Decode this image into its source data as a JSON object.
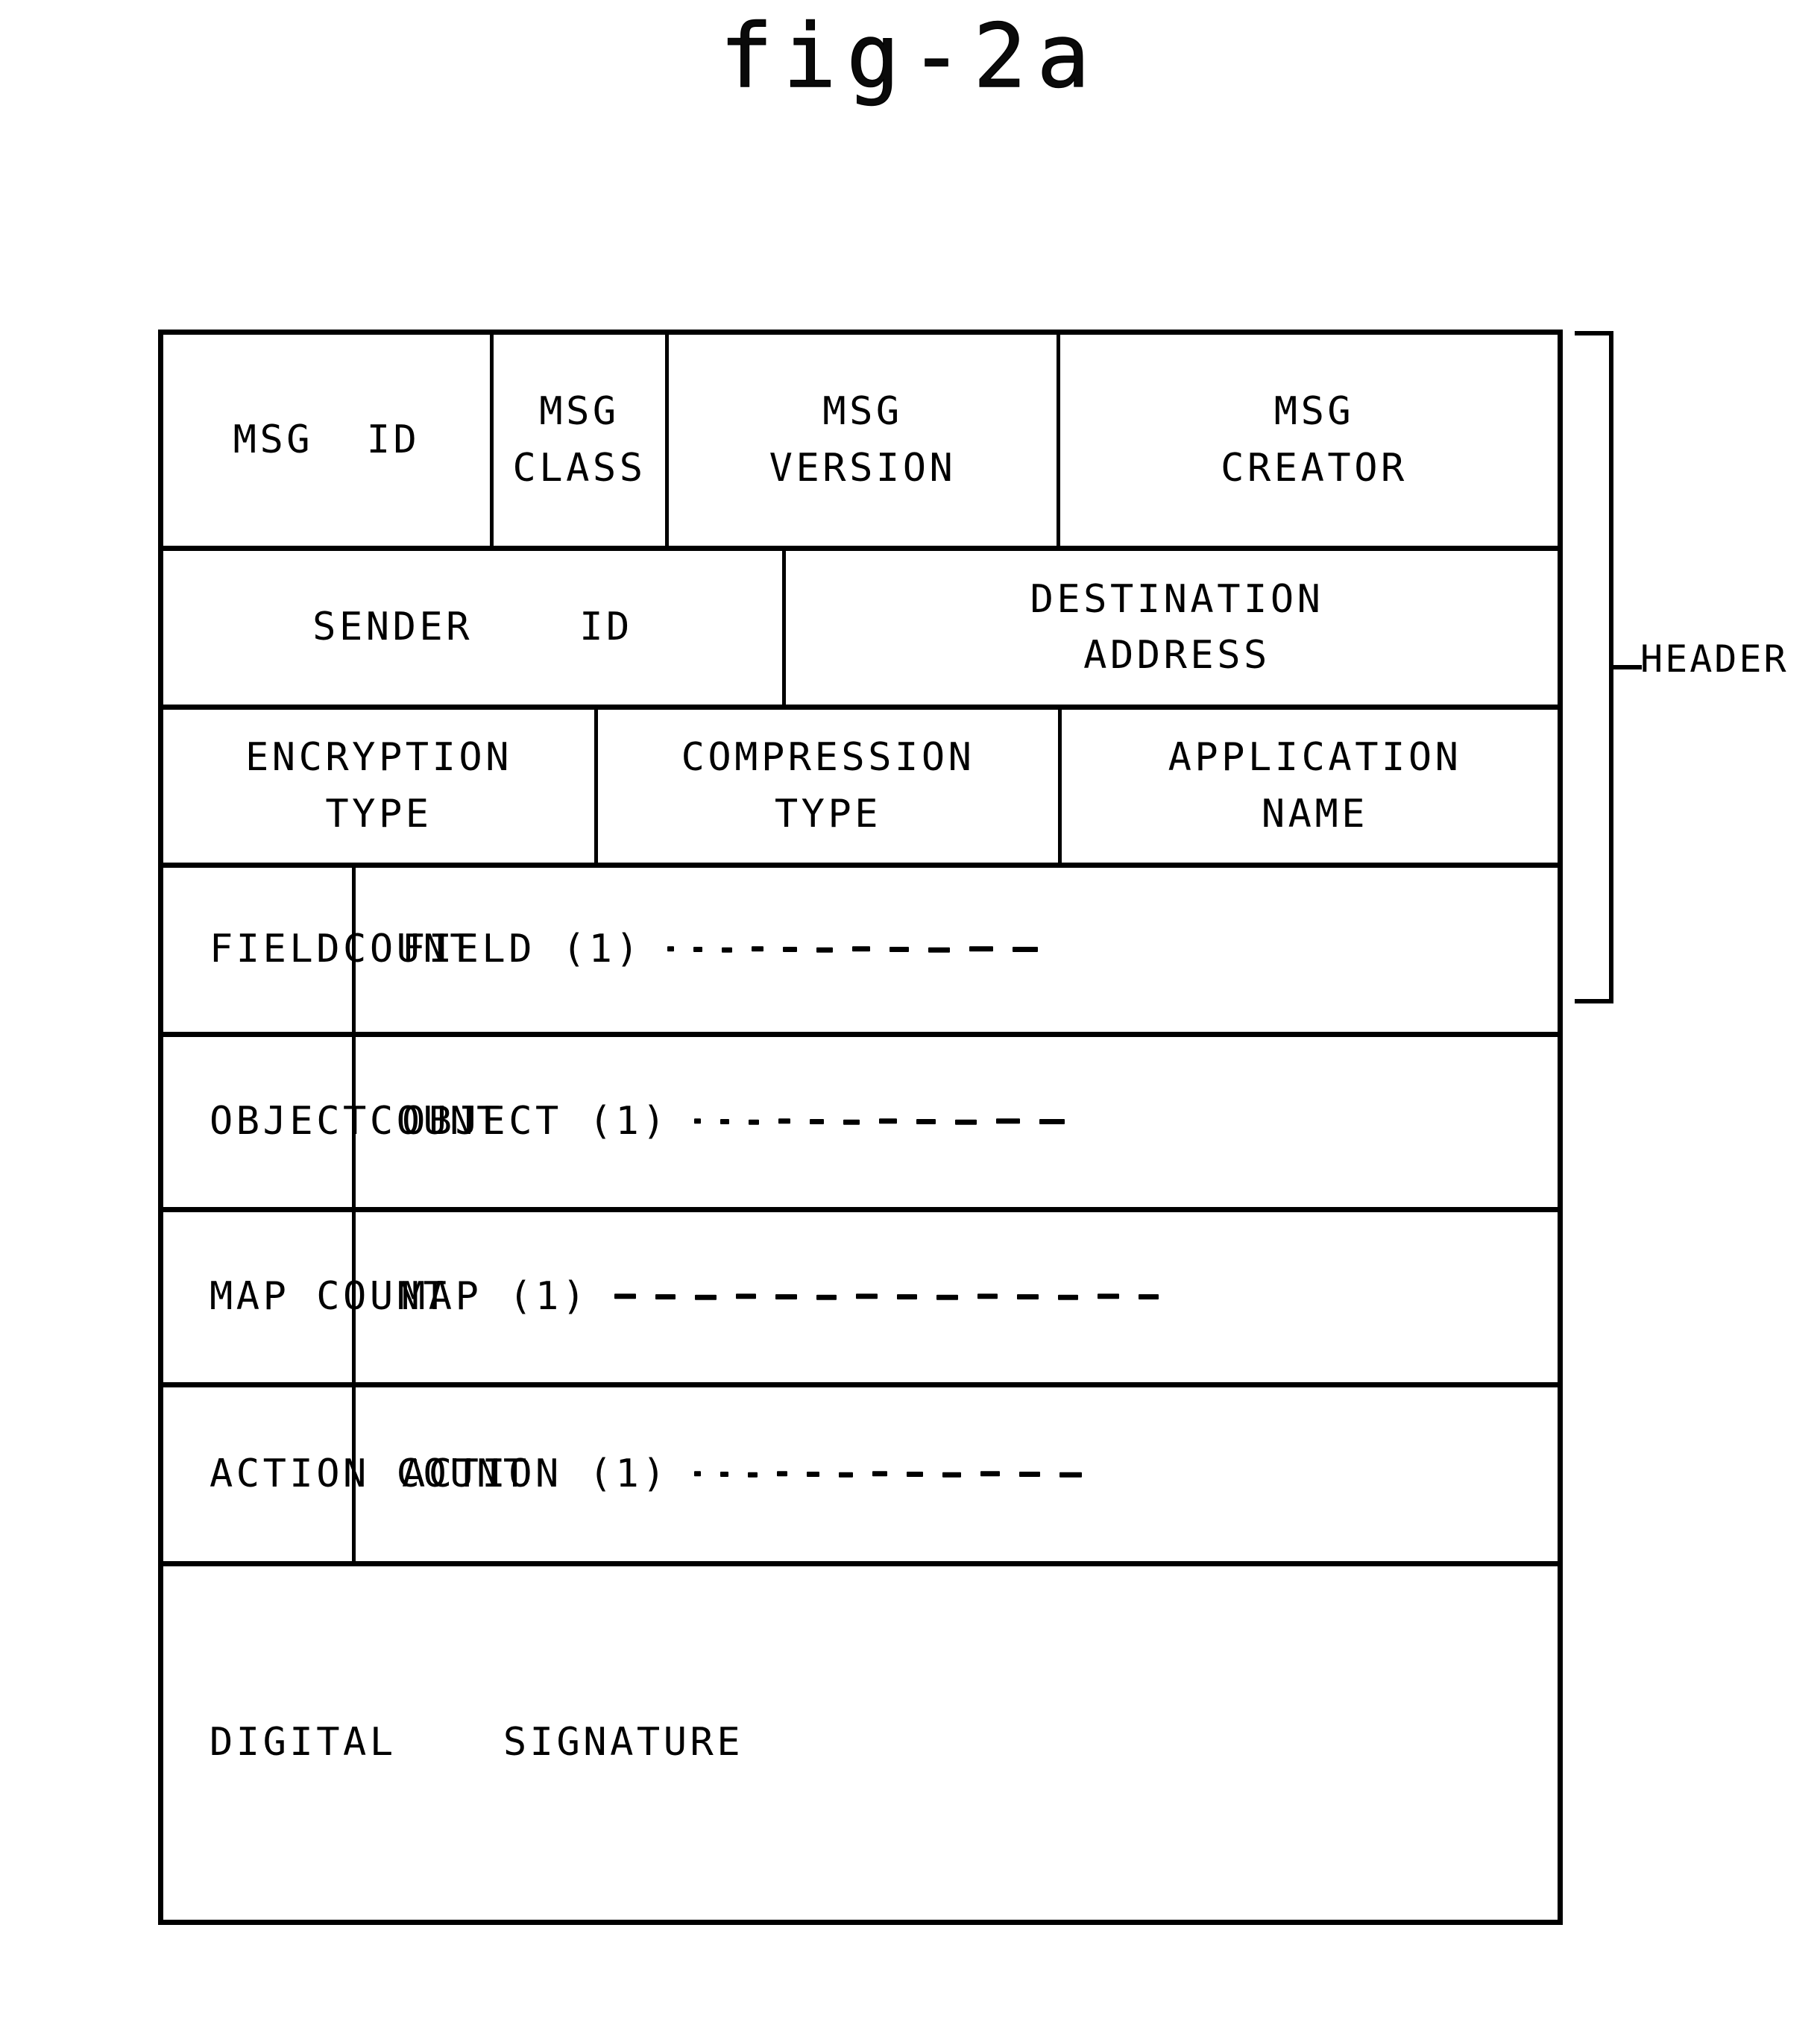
{
  "figure": {
    "title": "fig-2a",
    "caption_group_label": "HEADER"
  },
  "message_structure": {
    "rows": [
      {
        "row_id": "msg-identity-row",
        "cells": [
          {
            "label": "MSG  ID",
            "align": "center"
          },
          {
            "label": "MSG\nCLASS",
            "align": "center"
          },
          {
            "label": "MSG\nVERSION",
            "align": "center"
          },
          {
            "label": "MSG\nCREATOR",
            "align": "center"
          }
        ]
      },
      {
        "row_id": "addressing-row",
        "cells": [
          {
            "label": "SENDER    ID",
            "align": "center"
          },
          {
            "label": "DESTINATION\nADDRESS",
            "align": "center"
          }
        ]
      },
      {
        "row_id": "encoding-row",
        "cells": [
          {
            "label": "ENCRYPTION\nTYPE",
            "align": "center"
          },
          {
            "label": "COMPRESSION\nTYPE",
            "align": "center"
          },
          {
            "label": "APPLICATION\nNAME",
            "align": "center"
          }
        ]
      },
      {
        "row_id": "field-row",
        "cells": [
          {
            "label": "FIELDCOUNT",
            "align": "left"
          },
          {
            "label": "FIELD (1)",
            "align": "left",
            "leader": "dots"
          }
        ]
      },
      {
        "row_id": "object-row",
        "cells": [
          {
            "label": "OBJECTCOUNT",
            "align": "left"
          },
          {
            "label": "OBJECT (1)",
            "align": "left",
            "leader": "dots"
          }
        ]
      },
      {
        "row_id": "map-row",
        "cells": [
          {
            "label": "MAP COUNT",
            "align": "left"
          },
          {
            "label": "MAP (1)",
            "align": "left",
            "leader": "dashes"
          }
        ]
      },
      {
        "row_id": "action-row",
        "cells": [
          {
            "label": "ACTION COUNT",
            "align": "left"
          },
          {
            "label": "ACTION (1)",
            "align": "left",
            "leader": "dots"
          }
        ]
      },
      {
        "row_id": "signature-row",
        "cells": [
          {
            "label": "DIGITAL    SIGNATURE",
            "align": "left"
          }
        ]
      }
    ]
  },
  "colors": {
    "ink": "#000000",
    "paper": "#ffffff"
  }
}
